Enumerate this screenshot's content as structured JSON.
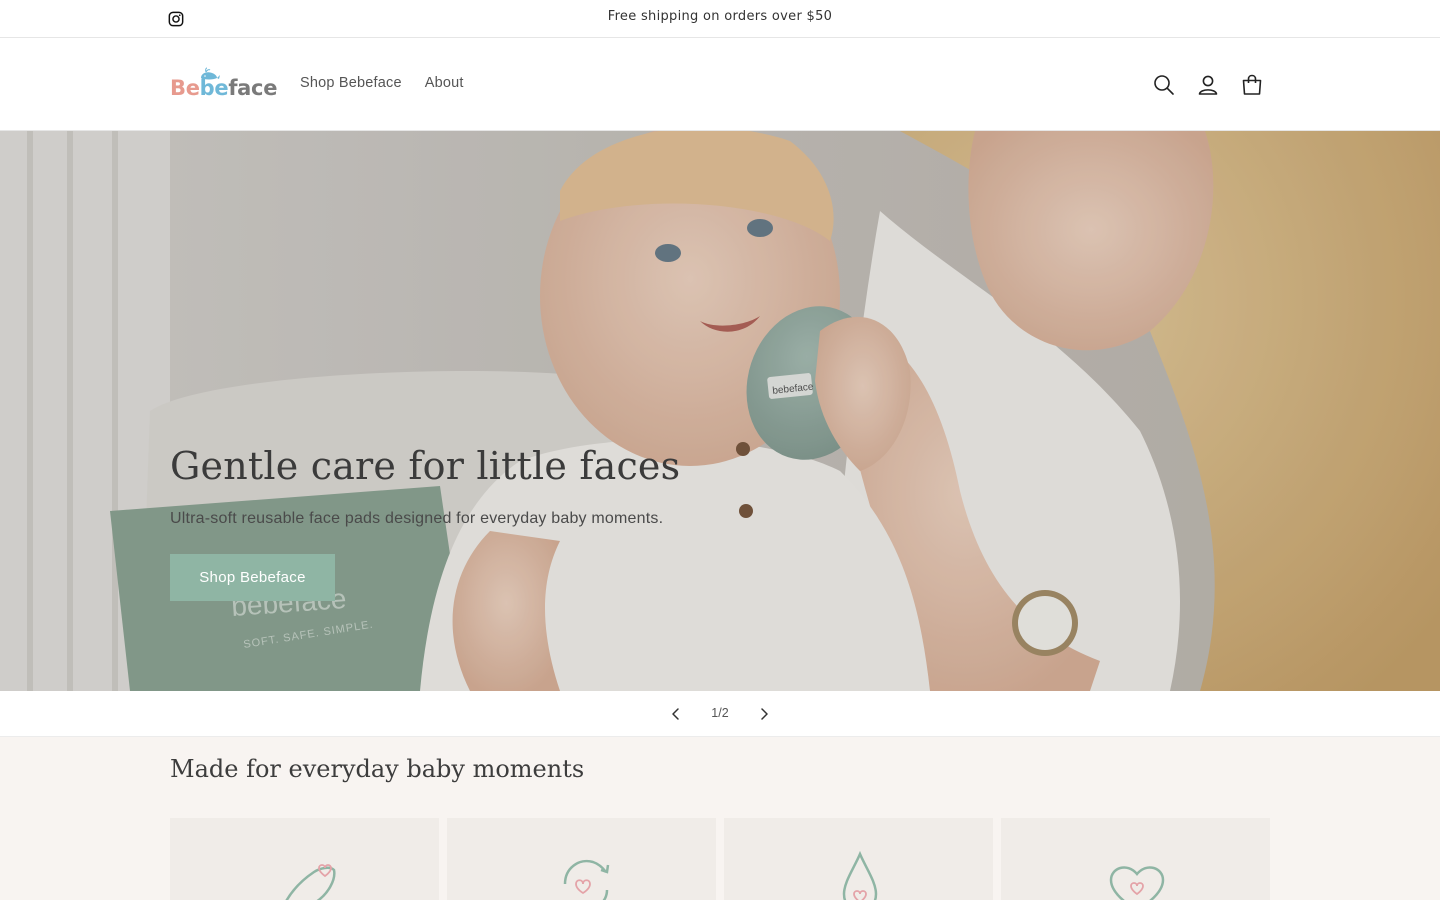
{
  "announcement": {
    "message": "Free shipping on orders over $50",
    "social_icon": "instagram-icon"
  },
  "header": {
    "logo": {
      "parts": [
        "Be",
        "be",
        "face"
      ],
      "alt": "Bebeface"
    },
    "nav": [
      {
        "label": "Shop Bebeface"
      },
      {
        "label": "About"
      }
    ],
    "icons": [
      "search-icon",
      "account-icon",
      "cart-icon"
    ]
  },
  "hero": {
    "title": "Gentle care for little faces",
    "subtitle": "Ultra-soft reusable face pads designed for everyday baby moments.",
    "button_label": "Shop Bebeface",
    "pad_label": "bebeface",
    "box_brand": "bebeface",
    "box_tagline": "SOFT. SAFE. SIMPLE."
  },
  "slider": {
    "counter": "1/2",
    "current": 1,
    "total": 2
  },
  "features": {
    "heading": "Made for everyday baby moments",
    "cards": [
      {
        "icon": "feather-heart-icon"
      },
      {
        "icon": "reusable-heart-icon"
      },
      {
        "icon": "drop-heart-icon"
      },
      {
        "icon": "heart-icon"
      }
    ]
  },
  "colors": {
    "accent": "#8fb5a4",
    "section_bg": "#f8f4f1",
    "card_bg": "#f0ece8",
    "icon_stroke": "#8fb5a4",
    "icon_heart": "#e4a3a8"
  }
}
